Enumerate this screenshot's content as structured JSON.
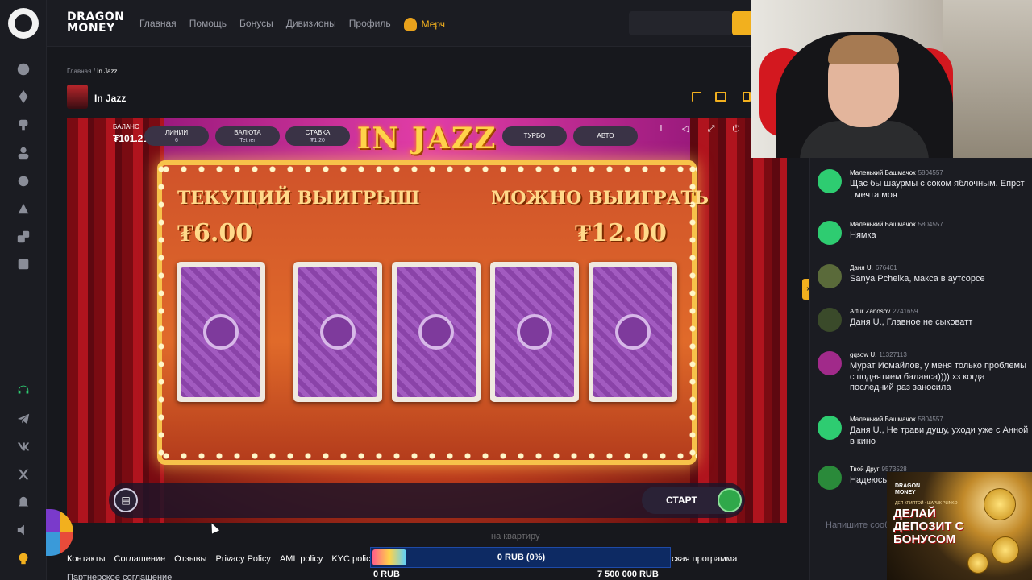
{
  "header": {
    "brand_line1": "DRAGON",
    "brand_line2": "MONEY",
    "nav": [
      "Главная",
      "Помощь",
      "Бонусы",
      "Дивизионы",
      "Профиль"
    ],
    "merch_label": "Мерч"
  },
  "breadcrumb": {
    "home": "Главная",
    "separator": "/",
    "current": "In Jazz"
  },
  "game_title": "In Jazz",
  "game": {
    "logo_text": "IN JAZZ",
    "balance_label": "БАЛАНС",
    "balance_value": "₮101.219",
    "current_win_label": "ТЕКУЩИЙ ВЫИГРЫШ",
    "current_win_value": "₮6.00",
    "possible_win_label": "МОЖНО ВЫИГРАТЬ",
    "possible_win_value": "₮12.00",
    "controls": {
      "lines_label": "ЛИНИИ",
      "lines_value": "6",
      "currency_label": "ВАЛЮТА",
      "currency_value": "Tether",
      "bet_label": "СТАВКА",
      "bet_value": "₮1.20",
      "turbo_label": "ТУРБО",
      "auto_label": "АВТО",
      "start_label": "СТАРТ"
    },
    "info_icon": "i"
  },
  "footer": {
    "links": [
      "Контакты",
      "Соглашение",
      "Отзывы",
      "Privacy Policy",
      "AML policy",
      "KYC policy"
    ],
    "partner_tail": "ская программа",
    "second_line": "Партнерское соглашение"
  },
  "overlay": {
    "progress_text": "0 RUB (0%)",
    "progress_fraction": 0,
    "min_value": "0 RUB",
    "max_value": "7 500 000 RUB",
    "faded_text": "на квартиру"
  },
  "chat": {
    "messages": [
      {
        "name": "Маленький Башмачок",
        "id": "5804557",
        "text": "Щас бы шаурмы с соком яблочным. Епрст , мечта моя",
        "avatar_color": "#2ecc71"
      },
      {
        "name": "Маленький Башмачок",
        "id": "5804557",
        "text": "Нямка",
        "avatar_color": "#2ecc71"
      },
      {
        "name": "Даня U.",
        "id": "676401",
        "text": "Sanya Pchelka, макса в аутсорсе",
        "avatar_color": "#5a6a3a"
      },
      {
        "name": "Artur Zanosov",
        "id": "2741659",
        "text": "Даня U., Главное не сыковатт",
        "avatar_color": "#3a4a2a"
      },
      {
        "name": "gqsow U.",
        "id": "11327113",
        "text": "Мурат Исмайлов, у меня только проблемы с поднятием баланса)))) хз когда последний раз заносила",
        "avatar_color": "#a12a8a"
      },
      {
        "name": "Маленький Башмачок",
        "id": "5804557",
        "text": "Даня U., Не трави душу, уходи уже с Анной в кино",
        "avatar_color": "#2ecc71"
      },
      {
        "name": "Твой Друг",
        "id": "9573528",
        "text": "Надеюсь",
        "avatar_color": "#2a8a3a"
      }
    ],
    "input_placeholder": "Напишите сообщ"
  },
  "promo": {
    "brand": "DRAGON MONEY",
    "small_text": "ДЕП КРИПТОЙ • ШАРИК PLINKO",
    "headline": "ДЕЛАЙ ДЕПОЗИТ С БОНУСОМ"
  },
  "colors": {
    "accent": "#f2b01e",
    "bg": "#17181d",
    "panel": "#1b1c22"
  }
}
